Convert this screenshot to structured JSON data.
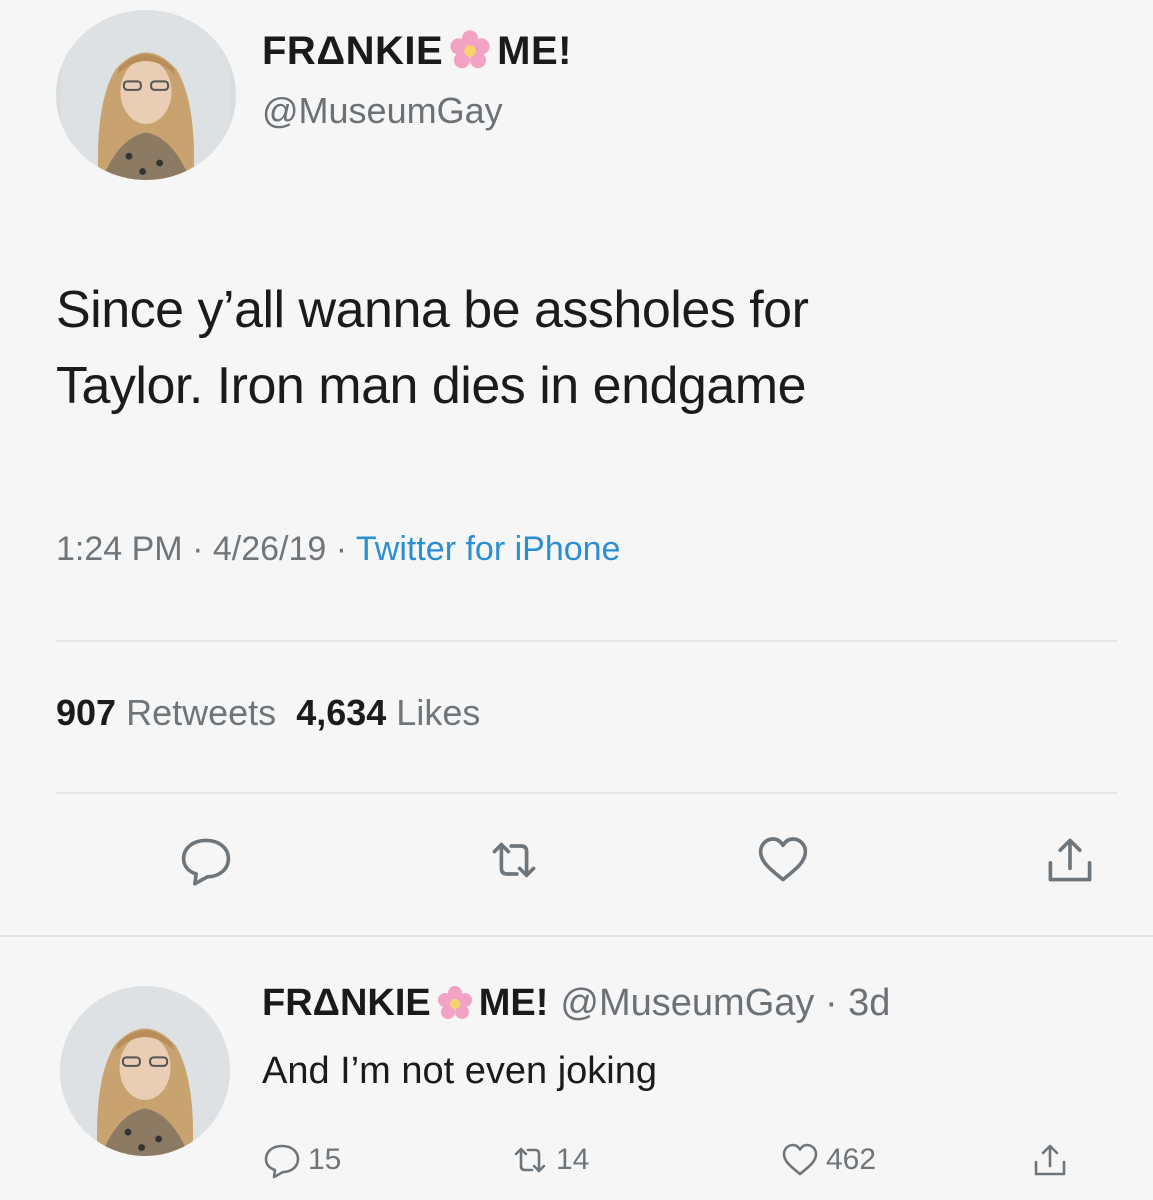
{
  "tweet": {
    "name_part1": "FRΔNKIE",
    "name_part2": "ME!",
    "handle": "@MuseumGay",
    "text_line1": "Since y’all wanna be assholes for",
    "text_line2": "Taylor. Iron man dies in endgame",
    "time": "1:24 PM",
    "sep1": " · ",
    "date": "4/26/19",
    "sep2": " · ",
    "source": "Twitter for iPhone",
    "retweet_count": "907",
    "retweet_label": "Retweets",
    "like_count": "4,634",
    "like_label": "Likes",
    "icons": [
      "reply-icon",
      "retweet-icon",
      "like-icon",
      "share-icon"
    ]
  },
  "reply": {
    "name_part1": "FRΔNKIE",
    "name_part2": "ME!",
    "handle_time": "@MuseumGay · 3d",
    "text": "And I’m not even joking",
    "reply_count": "15",
    "retweet_count": "14",
    "like_count": "462"
  },
  "colors": {
    "accent": "#2a8ed4",
    "muted": "#6f767b",
    "background": "#f6f6f6",
    "flower": "#f2a3c4"
  }
}
